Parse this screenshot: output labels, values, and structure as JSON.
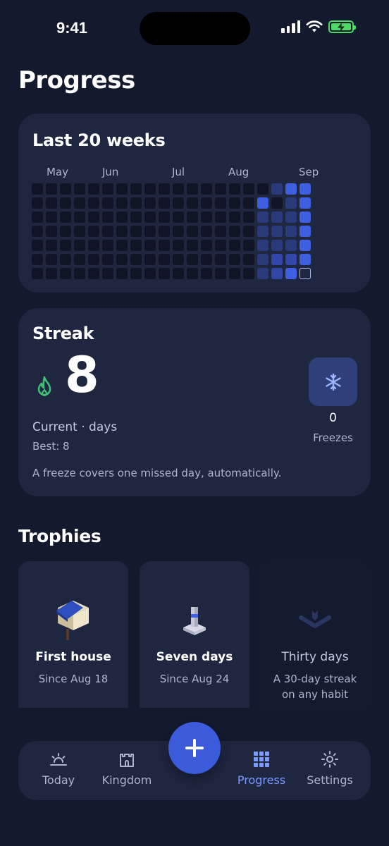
{
  "status": {
    "time": "9:41"
  },
  "page": {
    "title": "Progress"
  },
  "heatmap": {
    "title": "Last 20 weeks",
    "months": [
      "May",
      "Jun",
      "Jul",
      "Aug",
      "Sep"
    ],
    "weeks": 20,
    "days": 7,
    "colors": {
      "empty": "#0f1426",
      "low": "#283a7a",
      "mid": "#3148a8",
      "high": "#3d5fe0",
      "today_border": "#aeb8e8"
    },
    "active": [
      {
        "week": 16,
        "day": 1,
        "level": "high"
      },
      {
        "week": 16,
        "day": 2,
        "level": "low"
      },
      {
        "week": 16,
        "day": 3,
        "level": "low"
      },
      {
        "week": 16,
        "day": 4,
        "level": "low"
      },
      {
        "week": 16,
        "day": 5,
        "level": "low"
      },
      {
        "week": 16,
        "day": 6,
        "level": "low"
      },
      {
        "week": 17,
        "day": 0,
        "level": "low"
      },
      {
        "week": 17,
        "day": 2,
        "level": "low"
      },
      {
        "week": 17,
        "day": 3,
        "level": "low"
      },
      {
        "week": 17,
        "day": 4,
        "level": "low"
      },
      {
        "week": 17,
        "day": 5,
        "level": "mid"
      },
      {
        "week": 17,
        "day": 6,
        "level": "mid"
      },
      {
        "week": 18,
        "day": 0,
        "level": "high"
      },
      {
        "week": 18,
        "day": 1,
        "level": "low"
      },
      {
        "week": 18,
        "day": 2,
        "level": "low"
      },
      {
        "week": 18,
        "day": 3,
        "level": "low"
      },
      {
        "week": 18,
        "day": 4,
        "level": "low"
      },
      {
        "week": 18,
        "day": 5,
        "level": "mid"
      },
      {
        "week": 18,
        "day": 6,
        "level": "high"
      },
      {
        "week": 19,
        "day": 0,
        "level": "high"
      },
      {
        "week": 19,
        "day": 1,
        "level": "high"
      },
      {
        "week": 19,
        "day": 2,
        "level": "high"
      },
      {
        "week": 19,
        "day": 3,
        "level": "high"
      },
      {
        "week": 19,
        "day": 4,
        "level": "high"
      },
      {
        "week": 19,
        "day": 5,
        "level": "high"
      },
      {
        "week": 19,
        "day": 6,
        "level": "today"
      }
    ]
  },
  "streak": {
    "title": "Streak",
    "icon": "flame-icon",
    "current": "8",
    "subtitle": "Current · days",
    "best": "Best: 8",
    "note": "A freeze covers one missed day, automatically.",
    "freeze_icon": "snowflake-icon",
    "freeze_count": "0",
    "freeze_label": "Freezes"
  },
  "trophies": {
    "title": "Trophies",
    "items": [
      {
        "name": "First house",
        "sub": "Since Aug 18",
        "icon": "house-icon",
        "locked": false
      },
      {
        "name": "Seven days",
        "sub": "Since Aug 24",
        "icon": "pillar-icon",
        "locked": false
      },
      {
        "name": "Thirty days",
        "sub": "A 30-day streak on any habit",
        "icon": "chevron-down-icon",
        "locked": true
      }
    ]
  },
  "tabs": [
    {
      "label": "Today",
      "icon": "sunrise-icon",
      "active": false
    },
    {
      "label": "Kingdom",
      "icon": "castle-icon",
      "active": false
    },
    {
      "label": "Progress",
      "icon": "grid-icon",
      "active": true
    },
    {
      "label": "Settings",
      "icon": "gear-icon",
      "active": false
    }
  ],
  "fab": {
    "icon": "plus-icon"
  },
  "colors": {
    "background": "#131a2e",
    "card": "#1e2640",
    "accent": "#3b5bdb",
    "active_tab": "#7b9bff"
  }
}
